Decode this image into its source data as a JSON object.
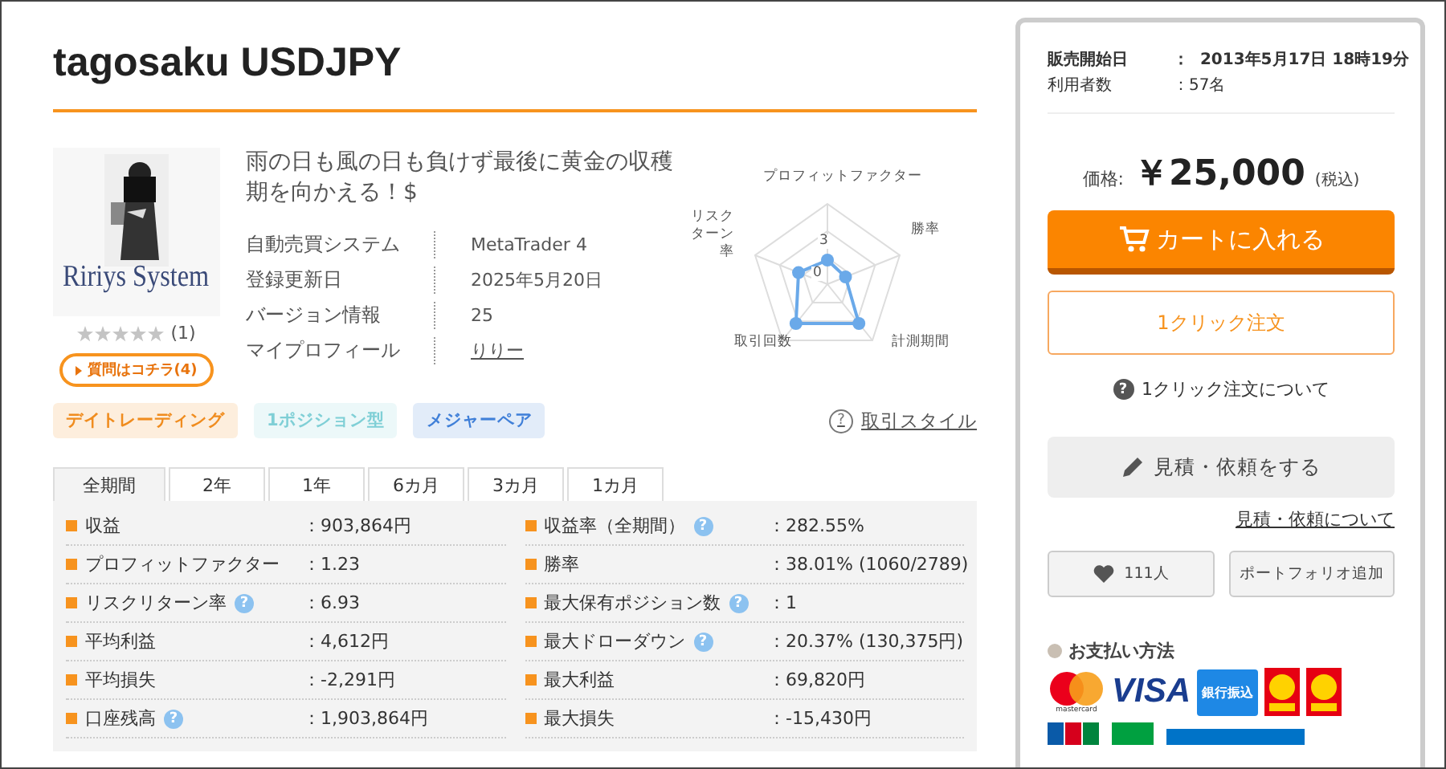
{
  "title": "tagosaku USDJPY",
  "product": {
    "image_caption": "Ririys System",
    "stars": 0,
    "rating_count": "(1)",
    "question_link": "質問はコチラ(4)",
    "description": "雨の日も風の日も負けず最後に黄金の収穫期を向かえる！$",
    "info": [
      {
        "label": "自動売買システム",
        "value": "MetaTrader 4",
        "link": false
      },
      {
        "label": "登録更新日",
        "value": "2025年5月20日",
        "link": false
      },
      {
        "label": "バージョン情報",
        "value": "25",
        "link": false
      },
      {
        "label": "マイプロフィール",
        "value": "りりー",
        "link": true
      }
    ]
  },
  "radar": {
    "axes": [
      "プロフィットファクター",
      "勝率",
      "計測期間",
      "取引回数",
      "リスクターン率"
    ],
    "ticks": [
      "3",
      "0"
    ]
  },
  "tags": [
    {
      "label": "デイトレーディング",
      "color": "#f08c1e"
    },
    {
      "label": "1ポジション型",
      "color": "#7fcfd6"
    },
    {
      "label": "メジャーペア",
      "color": "#3f7fd8"
    }
  ],
  "style_link": {
    "icon": "?",
    "label": "取引スタイル"
  },
  "tabs": [
    {
      "label": "全期間",
      "selected": true
    },
    {
      "label": "2年",
      "selected": false
    },
    {
      "label": "1年",
      "selected": false
    },
    {
      "label": "6カ月",
      "selected": false
    },
    {
      "label": "3カ月",
      "selected": false
    },
    {
      "label": "1カ月",
      "selected": false
    }
  ],
  "stats": [
    [
      {
        "label": "収益",
        "value": "：903,864円"
      },
      {
        "label": "収益率（全期間）",
        "help": "?",
        "value": "：282.55%"
      }
    ],
    [
      {
        "label": "プロフィットファクター",
        "value": "：1.23"
      },
      {
        "label": "勝率",
        "value": "：38.01% (1060/2789)"
      }
    ],
    [
      {
        "label": "リスクリターン率",
        "help": "?",
        "value": "：6.93"
      },
      {
        "label": "最大保有ポジション数",
        "help": "?",
        "value": "：1"
      }
    ],
    [
      {
        "label": "平均利益",
        "value": "：4,612円"
      },
      {
        "label": "最大ドローダウン",
        "help": "?",
        "value": "：20.37% (130,375円)"
      }
    ],
    [
      {
        "label": "平均損失",
        "value": "：-2,291円"
      },
      {
        "label": "最大利益",
        "value": "：69,820円"
      }
    ],
    [
      {
        "label": "口座残高",
        "help": "?",
        "value": "：1,903,864円"
      },
      {
        "label": "最大損失",
        "value": "：-15,430円"
      }
    ]
  ],
  "sidebar": {
    "meta": [
      {
        "label": "販売開始日",
        "value": "：  2013年5月17日 18時19分",
        "bold": true
      },
      {
        "label": "利用者数",
        "value": "：57名",
        "bold": false
      }
    ],
    "price_label": "価格:",
    "price": "￥25,000",
    "tax": "(税込)",
    "cart_button": "カートに入れる",
    "one_click_button": "1クリック注文",
    "one_click_help": {
      "icon": "?",
      "label": "1クリック注文について"
    },
    "quote_button": "見積・依頼をする",
    "quote_link": "見積・依頼について",
    "favorite_count": "111人",
    "portfolio_button": "ポートフォリオ追加",
    "payment_title": "お支払い方法",
    "payments": [
      {
        "kind": "mastercard",
        "label": "mastercard"
      },
      {
        "kind": "visa",
        "label": "VISA"
      },
      {
        "kind": "bank",
        "label": "銀行振込"
      },
      {
        "kind": "daily"
      },
      {
        "kind": "daily"
      }
    ]
  }
}
